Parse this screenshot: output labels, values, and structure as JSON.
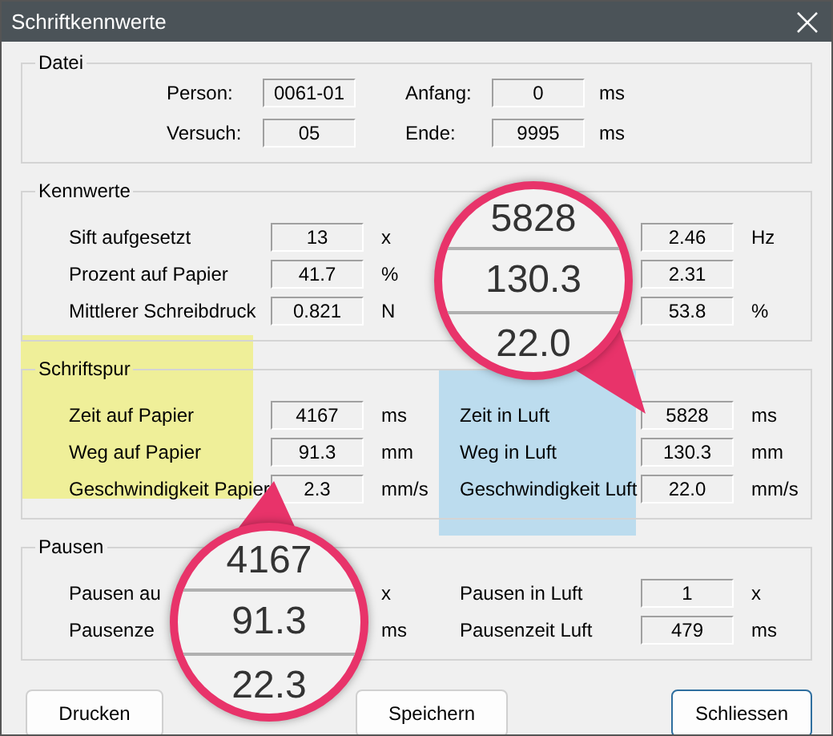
{
  "window": {
    "title": "Schriftkennwerte"
  },
  "highlights": [
    {
      "color": "#efef99"
    },
    {
      "color": "#bcdcee"
    }
  ],
  "groups": [
    {
      "title": "Datei",
      "kind": "file",
      "rows": [
        {
          "left": {
            "label": "Person:",
            "value": "0061-01"
          },
          "right": {
            "label": "Anfang:",
            "value": "0",
            "unit": "ms"
          }
        },
        {
          "left": {
            "label": "Versuch:",
            "value": "05"
          },
          "right": {
            "label": "Ende:",
            "value": "9995",
            "unit": "ms"
          }
        }
      ]
    },
    {
      "title": "Kennwerte",
      "kind": "stats",
      "rows": [
        {
          "left": {
            "label": "Sift aufgesetzt",
            "value": "13",
            "unit": "x"
          },
          "right": {
            "value": "2.46",
            "unit": "Hz"
          }
        },
        {
          "left": {
            "label": "Prozent auf Papier",
            "value": "41.7",
            "unit": "%"
          },
          "right": {
            "value": "2.31"
          }
        },
        {
          "left": {
            "label": "Mittlerer Schreibdruck",
            "value": "0.821",
            "unit": "N"
          },
          "right": {
            "value": "53.8",
            "unit": "%"
          }
        }
      ]
    },
    {
      "title": "Schriftspur",
      "kind": "stats",
      "rows": [
        {
          "left": {
            "label": "Zeit auf Papier",
            "value": "4167",
            "unit": "ms"
          },
          "right": {
            "label": "Zeit in Luft",
            "value": "5828",
            "unit": "ms"
          }
        },
        {
          "left": {
            "label": "Weg auf Papier",
            "value": "91.3",
            "unit": "mm"
          },
          "right": {
            "label": "Weg in Luft",
            "value": "130.3",
            "unit": "mm"
          }
        },
        {
          "left": {
            "label": "Geschwindigkeit Papier",
            "value": "2.3",
            "unit": "mm/s"
          },
          "right": {
            "label": "Geschwindigkeit Luft",
            "value": "22.0",
            "unit": "mm/s"
          }
        }
      ]
    },
    {
      "title": "Pausen",
      "kind": "stats",
      "rows": [
        {
          "left": {
            "label": "Pausen au",
            "unit": "x"
          },
          "right": {
            "label": "Pausen in Luft",
            "value": "1",
            "unit": "x"
          }
        },
        {
          "left": {
            "label": "Pausenze",
            "unit": "ms"
          },
          "right": {
            "label": "Pausenzeit Luft",
            "value": "479",
            "unit": "ms"
          }
        }
      ]
    }
  ],
  "buttons": [
    {
      "label": "Drucken",
      "default": false
    },
    {
      "label": "Speichern",
      "default": false
    },
    {
      "label": "Schliessen",
      "default": true
    }
  ],
  "magnifiers": [
    {
      "values": [
        "5828",
        "130.3",
        "22.0"
      ]
    },
    {
      "values": [
        "4167",
        "91.3",
        "22.3"
      ]
    }
  ]
}
